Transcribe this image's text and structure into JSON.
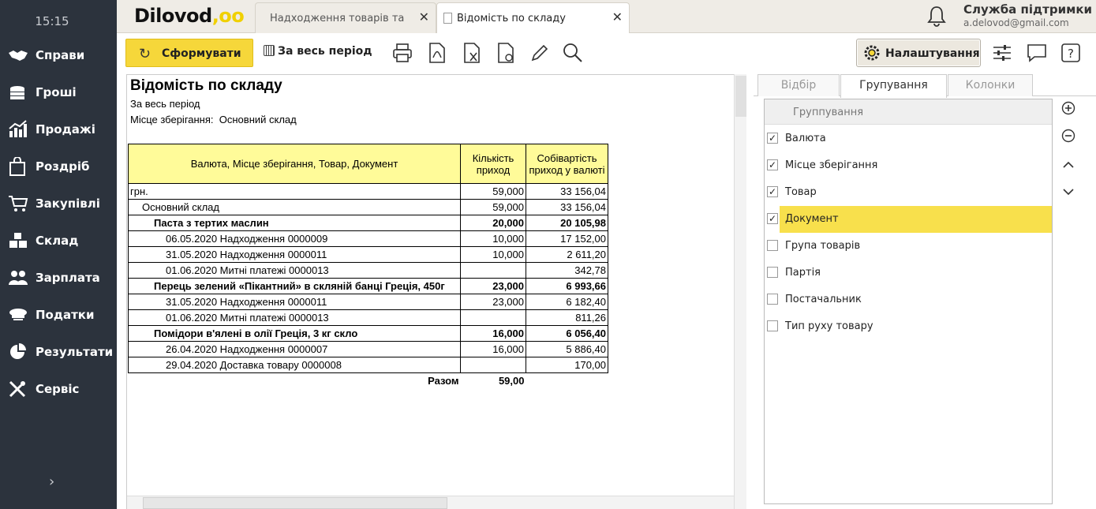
{
  "sidebar": {
    "clock": "15:15",
    "items": [
      {
        "label": "Справи",
        "icon": "handshake-icon"
      },
      {
        "label": "Гроші",
        "icon": "coins-icon"
      },
      {
        "label": "Продажі",
        "icon": "sales-chart-icon"
      },
      {
        "label": "Роздріб",
        "icon": "shopping-bag-icon"
      },
      {
        "label": "Закупівлі",
        "icon": "cart-icon"
      },
      {
        "label": "Склад",
        "icon": "boxes-icon"
      },
      {
        "label": "Зарплата",
        "icon": "people-icon"
      },
      {
        "label": "Податки",
        "icon": "officer-cap-icon"
      },
      {
        "label": "Результати",
        "icon": "pie-chart-icon"
      },
      {
        "label": "Сервіс",
        "icon": "tools-icon"
      }
    ],
    "collapse_glyph": "›"
  },
  "header": {
    "logo": "Dilovod",
    "logo_mark": ",oo",
    "tabs": [
      {
        "label": "Надходження товарів та послуг"
      },
      {
        "label": "Відомість по складу"
      }
    ],
    "support_title": "Служба підтримки",
    "support_email": "a.delovod@gmail.com"
  },
  "toolbar": {
    "form_label": "Сформувати",
    "period_label": "За весь період",
    "settings_label": "Налаштування"
  },
  "report": {
    "title": "Відомість по складу",
    "period": "За весь період",
    "storage_label": "Місце зберігання:",
    "storage_value": "Основний склад",
    "headers": [
      "Валюта, Місце зберігання, Товар, Документ",
      "Кількість приход",
      "Собівартість приход у валюті"
    ],
    "rows": [
      {
        "name": "грн.",
        "qty": "59,000",
        "cost": "33 156,04",
        "level": 0,
        "bold": false
      },
      {
        "name": "Основний склад",
        "qty": "59,000",
        "cost": "33 156,04",
        "level": 1,
        "bold": false
      },
      {
        "name": "Паста з тертих маслин",
        "qty": "20,000",
        "cost": "20 105,98",
        "level": 2,
        "bold": true
      },
      {
        "name": "06.05.2020 Надходження 0000009",
        "qty": "10,000",
        "cost": "17 152,00",
        "level": 3,
        "bold": false
      },
      {
        "name": "31.05.2020 Надходження 0000011",
        "qty": "10,000",
        "cost": "2 611,20",
        "level": 3,
        "bold": false
      },
      {
        "name": "01.06.2020 Митні платежі 0000013",
        "qty": "",
        "cost": "342,78",
        "level": 3,
        "bold": false
      },
      {
        "name": "Перець зелений «Пікантний» в скляній банці Греція, 450г",
        "qty": "23,000",
        "cost": "6 993,66",
        "level": 2,
        "bold": true
      },
      {
        "name": "31.05.2020 Надходження 0000011",
        "qty": "23,000",
        "cost": "6 182,40",
        "level": 3,
        "bold": false
      },
      {
        "name": "01.06.2020 Митні платежі 0000013",
        "qty": "",
        "cost": "811,26",
        "level": 3,
        "bold": false
      },
      {
        "name": "Помідори в'ялені в олії Греція, 3 кг скло",
        "qty": "16,000",
        "cost": "6 056,40",
        "level": 2,
        "bold": true
      },
      {
        "name": "26.04.2020 Надходження 0000007",
        "qty": "16,000",
        "cost": "5 886,40",
        "level": 3,
        "bold": false
      },
      {
        "name": "29.04.2020 Доставка товару 0000008",
        "qty": "",
        "cost": "170,00",
        "level": 3,
        "bold": false
      }
    ],
    "total_label": "Разом",
    "total_qty": "59,00"
  },
  "panel": {
    "tabs": [
      "Відбір",
      "Групування",
      "Колонки"
    ],
    "active_tab": "Групування",
    "grouping_header": "Группування",
    "groupings": [
      {
        "label": "Валюта",
        "checked": true
      },
      {
        "label": "Місце зберігання",
        "checked": true
      },
      {
        "label": "Товар",
        "checked": true
      },
      {
        "label": "Документ",
        "checked": true,
        "selected": true
      },
      {
        "label": "Група товарів",
        "checked": false
      },
      {
        "label": "Партія",
        "checked": false
      },
      {
        "label": "Постачальник",
        "checked": false
      },
      {
        "label": "Тип руху товару",
        "checked": false
      }
    ],
    "highlight_color": "#f8e04c"
  },
  "colors": {
    "sidebar_bg": "#2c333d",
    "accent": "#f6d73a",
    "header_fill": "#fffb99"
  }
}
